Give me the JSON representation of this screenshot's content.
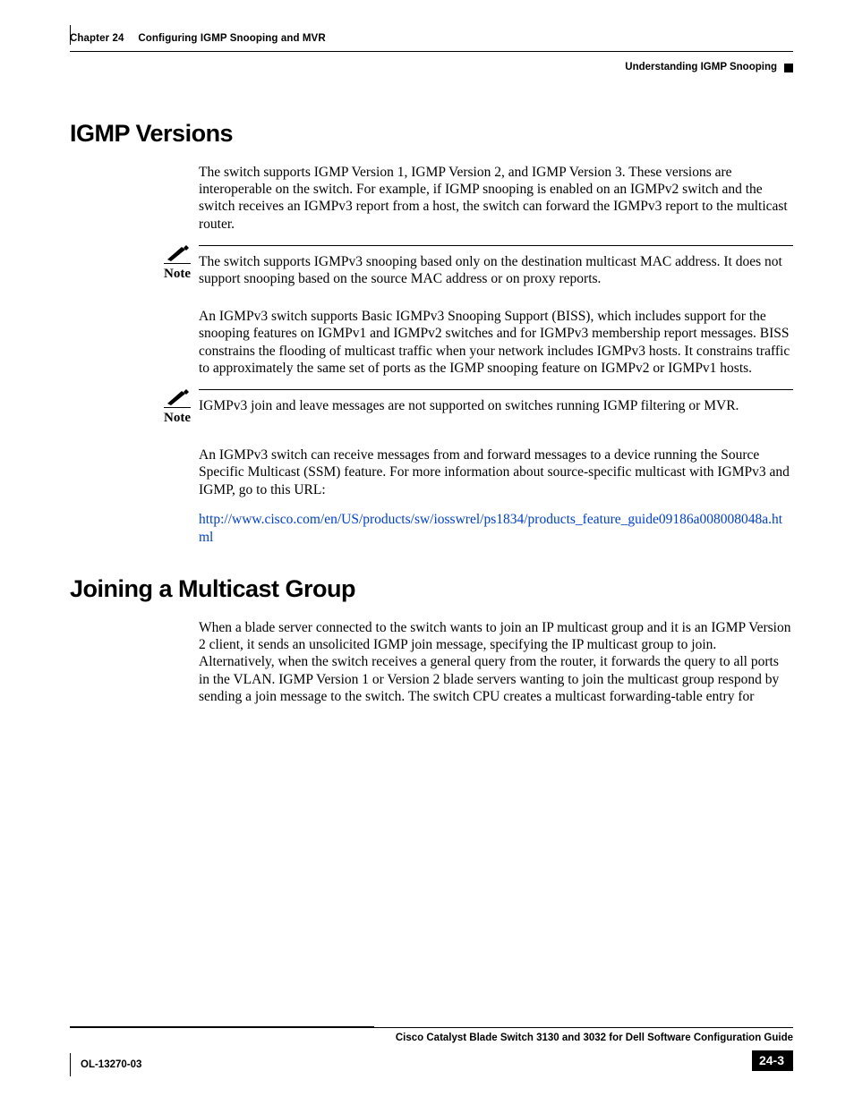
{
  "header": {
    "chapter_label": "Chapter 24",
    "chapter_title": "Configuring IGMP Snooping and MVR",
    "section_title": "Understanding IGMP Snooping"
  },
  "section1": {
    "heading": "IGMP Versions",
    "p1": "The switch supports IGMP Version 1, IGMP Version 2, and IGMP Version 3. These versions are interoperable on the switch. For example, if IGMP snooping is enabled on an IGMPv2 switch and the switch receives an IGMPv3 report from a host, the switch can forward the IGMPv3 report to the multicast router.",
    "note1_label": "Note",
    "note1_text": "The switch supports IGMPv3 snooping based only on the destination multicast MAC address. It does not support snooping based on the source MAC address or on proxy reports.",
    "p2": "An IGMPv3 switch supports Basic IGMPv3 Snooping Support (BISS), which includes support for the snooping features on IGMPv1 and IGMPv2 switches and for IGMPv3 membership report messages. BISS constrains the flooding of multicast traffic when your network includes IGMPv3 hosts. It constrains traffic to approximately the same set of ports as the IGMP snooping feature on IGMPv2 or IGMPv1 hosts.",
    "note2_label": "Note",
    "note2_text": "IGMPv3 join and leave messages are not supported on switches running IGMP filtering or MVR.",
    "p3": "An IGMPv3 switch can receive messages from and forward messages to a device running the Source Specific Multicast (SSM) feature. For more information about source-specific multicast with IGMPv3 and IGMP, go to this URL:",
    "link_text": "http://www.cisco.com/en/US/products/sw/iosswrel/ps1834/products_feature_guide09186a008008048a.html"
  },
  "section2": {
    "heading": "Joining a Multicast Group",
    "p1": "When a blade server connected to the switch wants to join an IP multicast group and it is an IGMP Version 2 client, it sends an unsolicited IGMP join message, specifying the IP multicast group to join. Alternatively, when the switch receives a general query from the router, it forwards the query to all ports in the VLAN. IGMP Version 1 or Version 2 blade servers wanting to join the multicast group respond by sending a join message to the switch. The switch CPU creates a multicast forwarding-table entry for"
  },
  "footer": {
    "guide_title": "Cisco Catalyst Blade Switch 3130 and 3032 for Dell Software Configuration Guide",
    "doc_id": "OL-13270-03",
    "page_number": "24-3"
  }
}
